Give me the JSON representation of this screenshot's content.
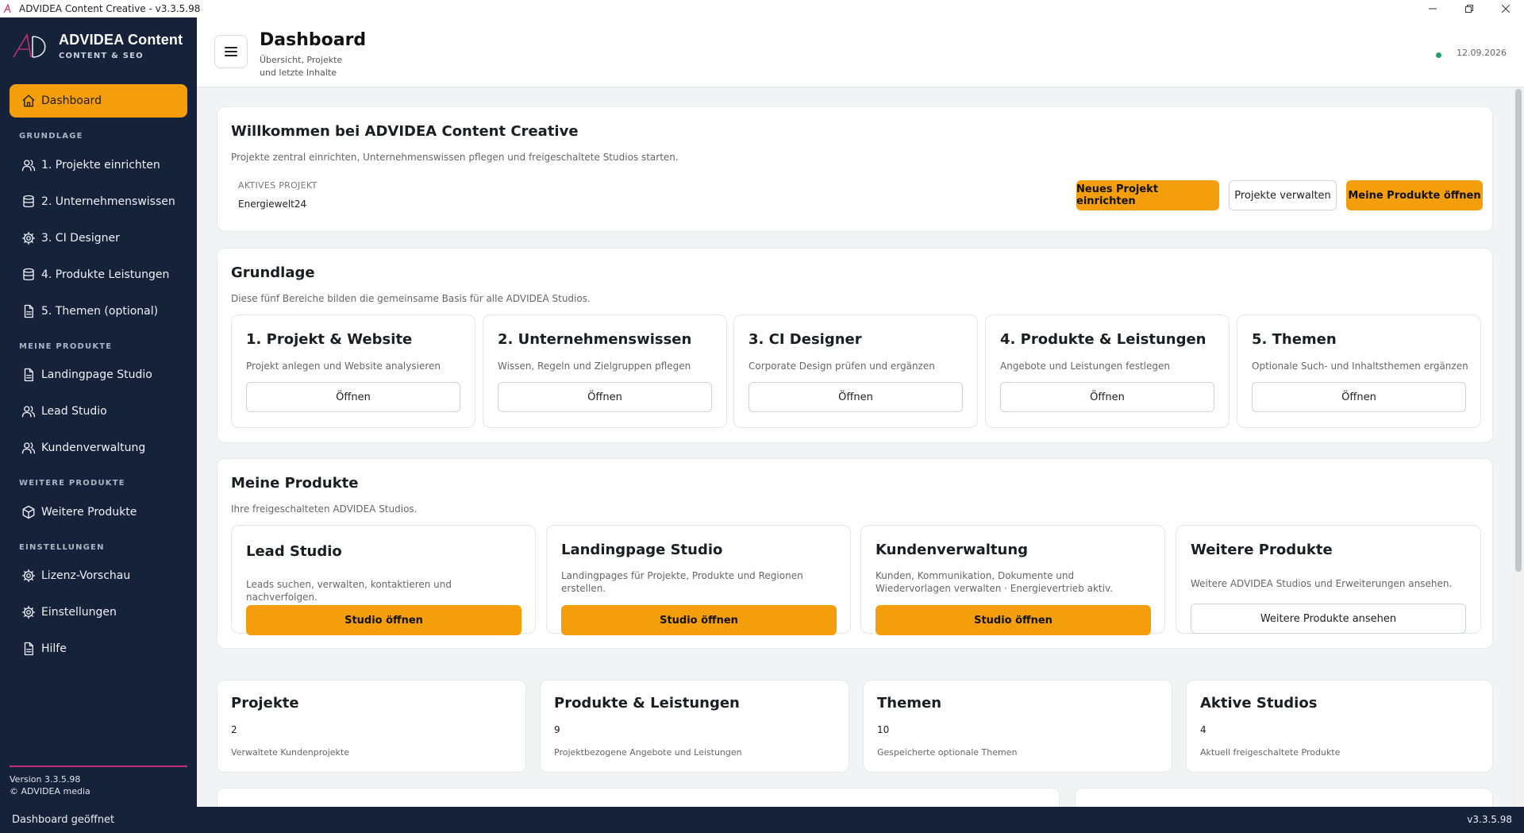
{
  "window": {
    "title": "ADVIDEA Content Creative - v3.3.5.98"
  },
  "brand": {
    "name": "ADVIDEA Content",
    "subtitle": "CONTENT & SEO",
    "logo_text": "AD"
  },
  "sidebar": {
    "dashboard": "Dashboard",
    "sections": {
      "grundlage": "GRUNDLAGE",
      "meine_produkte": "MEINE PRODUKTE",
      "weitere_produkte": "WEITERE PRODUKTE",
      "einstellungen": "EINSTELLUNGEN"
    },
    "grundlage_items": [
      {
        "label": "1. Projekte einrichten",
        "icon": "users-icon"
      },
      {
        "label": "2. Unternehmenswissen",
        "icon": "database-icon"
      },
      {
        "label": "3. CI Designer",
        "icon": "gear-icon"
      },
      {
        "label": "4. Produkte  Leistungen",
        "icon": "database-icon"
      },
      {
        "label": "5. Themen (optional)",
        "icon": "document-icon"
      }
    ],
    "produkte_items": [
      {
        "label": "Landingpage Studio",
        "icon": "document-icon"
      },
      {
        "label": "Lead Studio",
        "icon": "users-icon"
      },
      {
        "label": "Kundenverwaltung",
        "icon": "users-icon"
      }
    ],
    "weitere_items": [
      {
        "label": "Weitere Produkte",
        "icon": "cube-icon"
      }
    ],
    "settings_items": [
      {
        "label": "Lizenz-Vorschau",
        "icon": "gear-icon"
      },
      {
        "label": "Einstellungen",
        "icon": "gear-icon"
      },
      {
        "label": "Hilfe",
        "icon": "document-icon"
      }
    ],
    "version": "Version 3.3.5.98",
    "copyright": "© ADVIDEA media"
  },
  "header": {
    "title": "Dashboard",
    "subtitle": "Übersicht, Projekte und letzte Inhalte",
    "date": "12.09.2026"
  },
  "welcome": {
    "title": "Willkommen bei ADVIDEA Content Creative",
    "description": "Projekte zentral einrichten, Unternehmenswissen pflegen und freigeschaltete Studios starten.",
    "active_label": "AKTIVES PROJEKT",
    "active_value": "Energiewelt24",
    "btn_new": "Neues Projekt einrichten",
    "btn_manage": "Projekte verwalten",
    "btn_products": "Meine Produkte öffnen"
  },
  "grundlage": {
    "title": "Grundlage",
    "description": "Diese fünf Bereiche bilden die gemeinsame Basis für alle ADVIDEA Studios.",
    "cards": [
      {
        "title": "1. Projekt & Website",
        "desc": "Projekt anlegen und Website analysieren",
        "button": "Öffnen"
      },
      {
        "title": "2. Unternehmenswissen",
        "desc": "Wissen, Regeln und Zielgruppen pflegen",
        "button": "Öffnen"
      },
      {
        "title": "3. CI Designer",
        "desc": "Corporate Design prüfen und ergänzen",
        "button": "Öffnen"
      },
      {
        "title": "4. Produkte & Leistungen",
        "desc": "Angebote und Leistungen festlegen",
        "button": "Öffnen"
      },
      {
        "title": "5. Themen",
        "desc": "Optionale Such- und Inhaltsthemen ergänzen",
        "button": "Öffnen"
      }
    ]
  },
  "produkte": {
    "title": "Meine Produkte",
    "description": "Ihre freigeschalteten ADVIDEA Studios.",
    "cards": [
      {
        "title": "Lead Studio",
        "desc": "Leads suchen, verwalten, kontaktieren und nachverfolgen.",
        "button": "Studio öffnen"
      },
      {
        "title": "Landingpage Studio",
        "desc": "Landingpages für Projekte, Produkte und Regionen erstellen.",
        "button": "Studio öffnen"
      },
      {
        "title": "Kundenverwaltung",
        "desc": "Kunden, Kommunikation, Dokumente und Wiedervorlagen verwalten · Energievertrieb aktiv.",
        "button": "Studio öffnen"
      },
      {
        "title": "Weitere Produkte",
        "desc": "Weitere ADVIDEA Studios und Erweiterungen ansehen.",
        "button": "Weitere Produkte ansehen"
      }
    ]
  },
  "stats": [
    {
      "title": "Projekte",
      "value": "2",
      "desc": "Verwaltete Kundenprojekte"
    },
    {
      "title": "Produkte & Leistungen",
      "value": "9",
      "desc": "Projektbezogene Angebote und Leistungen"
    },
    {
      "title": "Themen",
      "value": "10",
      "desc": "Gespeicherte optionale Themen"
    },
    {
      "title": "Aktive Studios",
      "value": "4",
      "desc": "Aktuell freigeschaltete Produkte"
    }
  ],
  "statusbar": {
    "message": "Dashboard geöffnet",
    "version": "v3.3.5.98"
  },
  "colors": {
    "accent": "#f59e0b",
    "sidebar_bg": "#16213a",
    "brand_line": "#c0307a",
    "status_ok": "#22a06b"
  }
}
